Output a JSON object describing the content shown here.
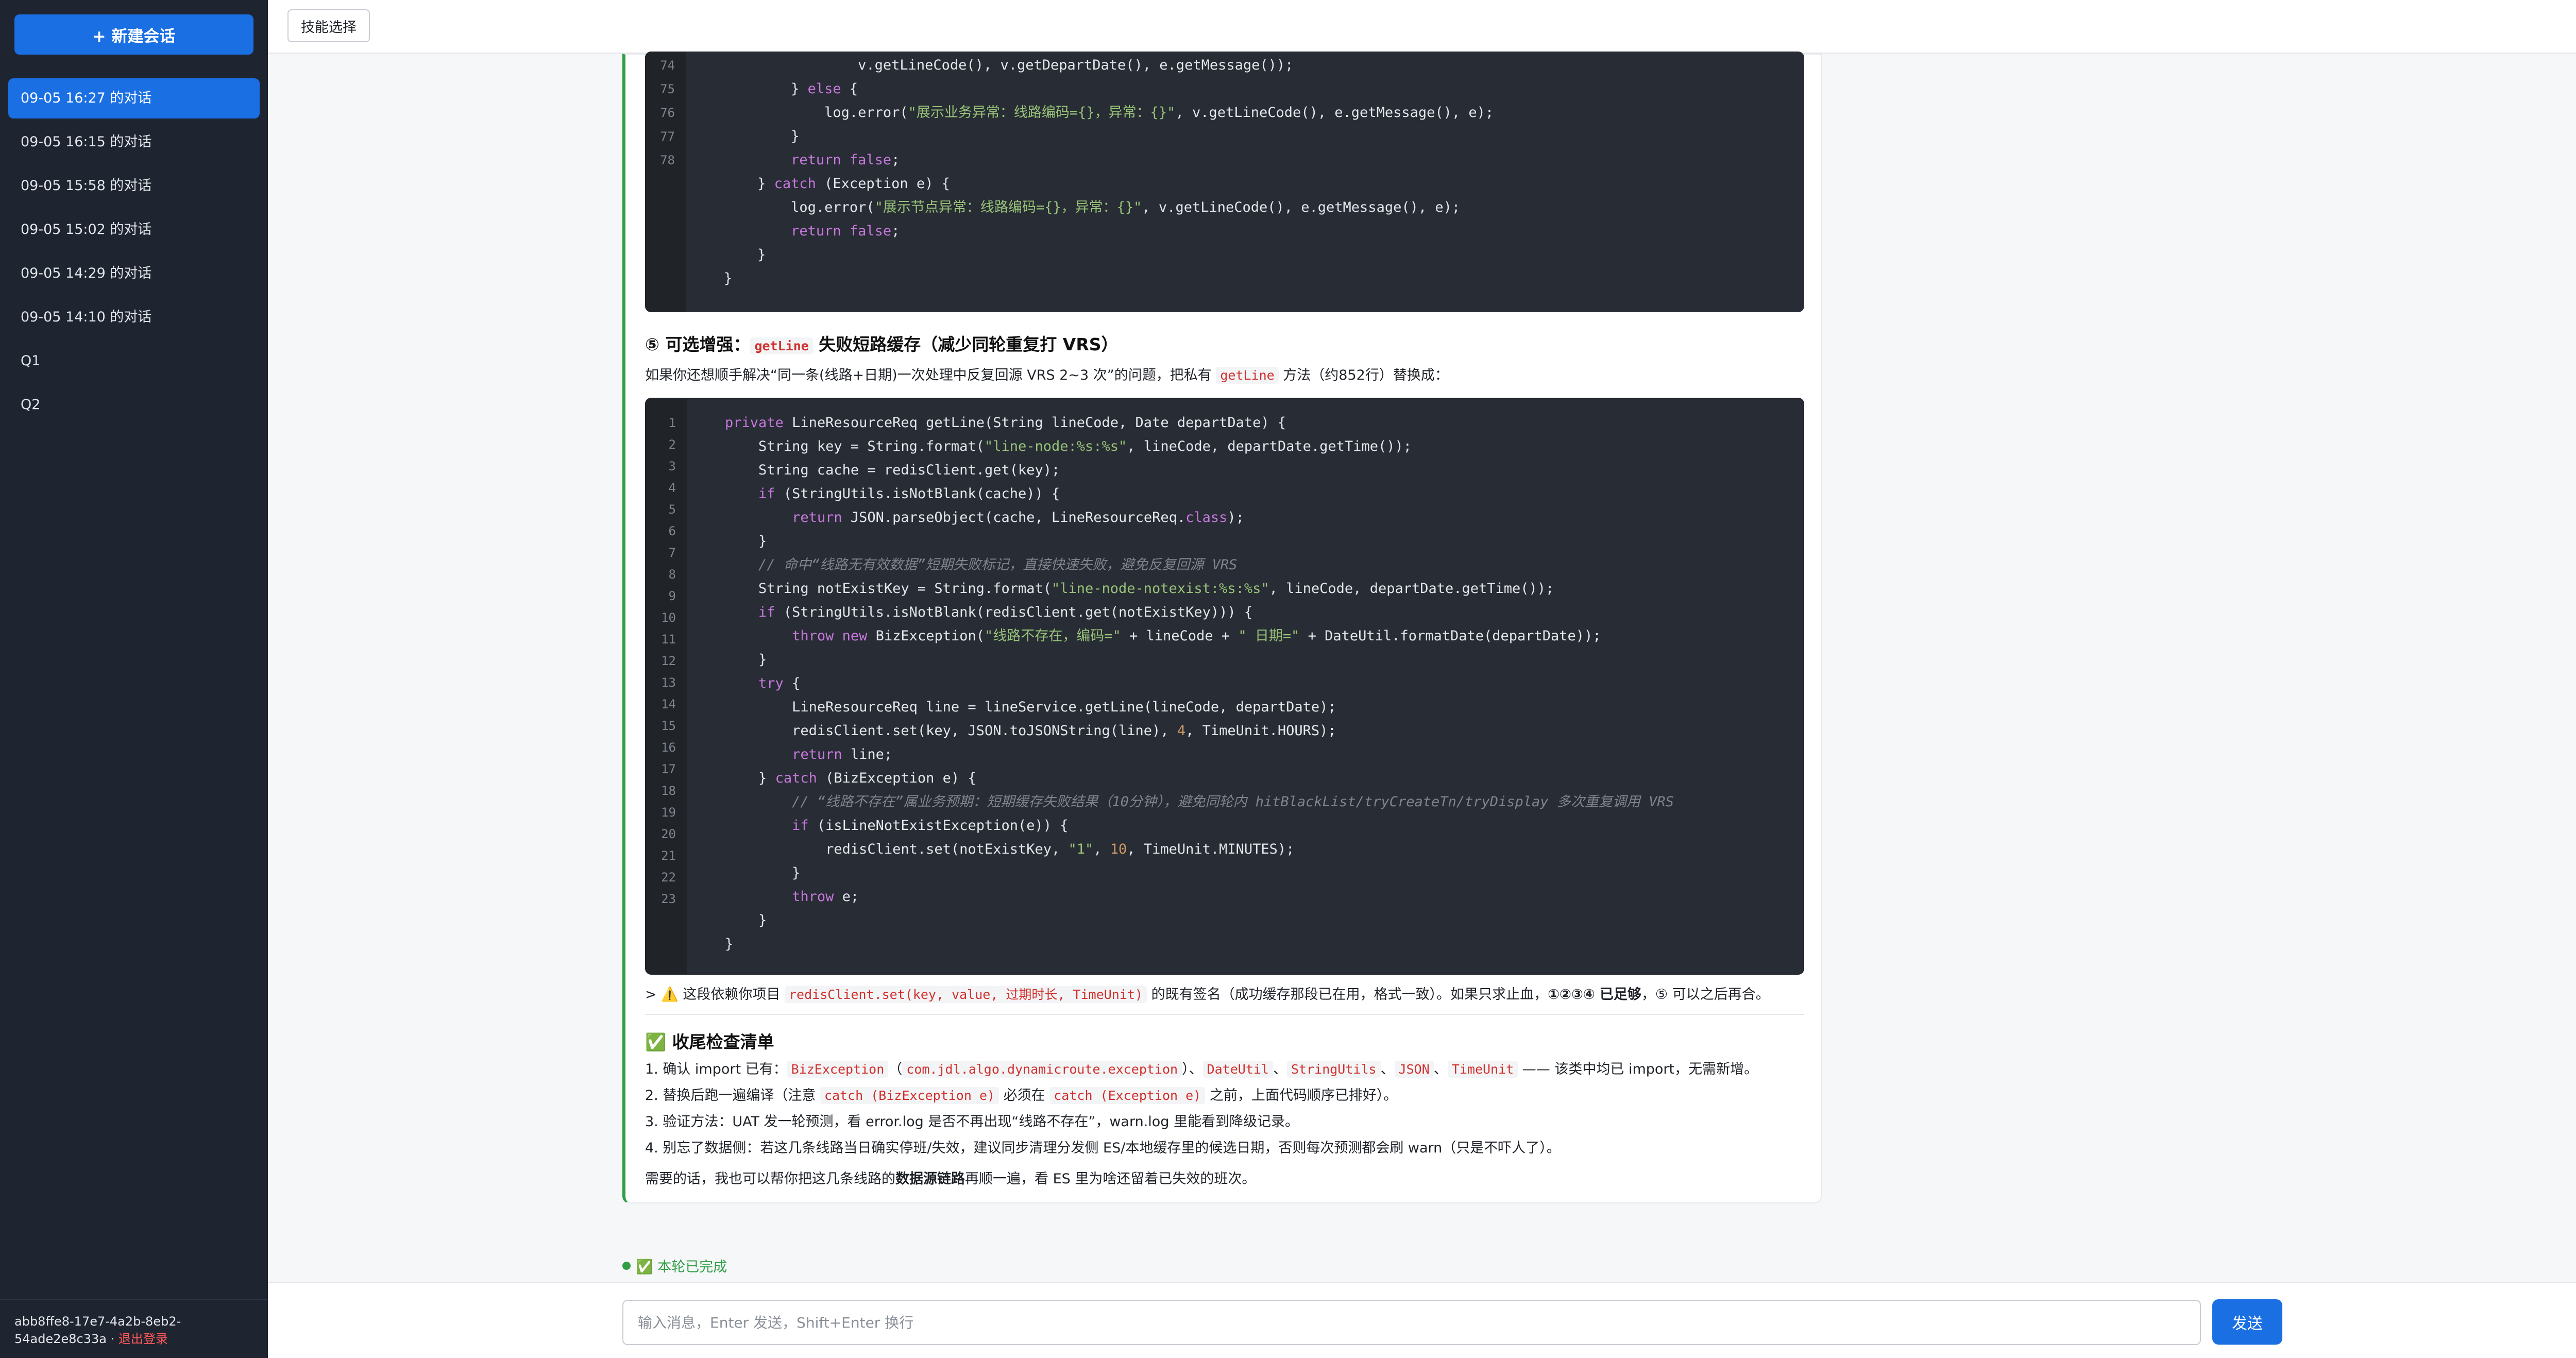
{
  "sidebar": {
    "new_chat_label": "+ 新建会话",
    "conversations": [
      "09-05 16:27 的对话",
      "09-05 16:15 的对话",
      "09-05 15:58 的对话",
      "09-05 15:02 的对话",
      "09-05 14:29 的对话",
      "09-05 14:10 的对话",
      "Q1",
      "Q2"
    ],
    "user_id_line1": "abb8ffe8-17e7-4a2b-8eb2-",
    "user_id_line2": "54ade2e8c33a · ",
    "logout_label": "退出登录"
  },
  "topbar": {
    "skill_label": "技能选择"
  },
  "message": {
    "code1": {
      "lines": [
        {
          "no": "74",
          "html": "                    v.getLineCode(), v.getDepartDate(), e.getMessage());"
        },
        {
          "no": "75",
          "html": "            } <span class='k'>else</span> {"
        },
        {
          "no": "76",
          "html": "                log.error(<span class='s'>\"展示业务异常：线路编码={}，异常：{}\"</span>, v.getLineCode(), e.getMessage(), e);"
        },
        {
          "no": "77",
          "html": "            }"
        },
        {
          "no": "78",
          "html": "            <span class='k'>return</span> <span class='k'>false</span>;"
        },
        {
          "no": "",
          "html": "        } <span class='k'>catch</span> (Exception e) {"
        },
        {
          "no": "",
          "html": "            log.error(<span class='s'>\"展示节点异常：线路编码={}，异常：{}\"</span>, v.getLineCode(), e.getMessage(), e);"
        },
        {
          "no": "",
          "html": "            <span class='k'>return</span> <span class='k'>false</span>;"
        },
        {
          "no": "",
          "html": "        }"
        },
        {
          "no": "",
          "html": "    }"
        }
      ]
    },
    "section5": {
      "title_pre": "⑤ 可选增强：",
      "title_code": "getLine",
      "title_post": " 失败短路缓存（减少同轮重复打 VRS）",
      "desc_pre": "如果你还想顺手解决“同一条(线路+日期)一次处理中反复回源 VRS 2~3 次”的问题，把私有 ",
      "desc_code": "getLine",
      "desc_post": " 方法（约852行）替换成："
    },
    "code2": {
      "lines": [
        {
          "no": "1",
          "html": "    <span class='k'>private</span> LineResourceReq getLine(String lineCode, Date departDate) {"
        },
        {
          "no": "2",
          "html": "        String key = String.format(<span class='s'>\"line-node:%s:%s\"</span>, lineCode, departDate.getTime());"
        },
        {
          "no": "3",
          "html": "        String cache = redisClient.get(key);"
        },
        {
          "no": "4",
          "html": "        <span class='k'>if</span> (StringUtils.isNotBlank(cache)) {"
        },
        {
          "no": "5",
          "html": "            <span class='k'>return</span> JSON.parseObject(cache, LineResourceReq.<span class='k'>class</span>);"
        },
        {
          "no": "6",
          "html": "        }"
        },
        {
          "no": "7",
          "html": "        <span class='c'>// 命中“线路无有效数据”短期失败标记，直接快速失败，避免反复回源 VRS</span>"
        },
        {
          "no": "8",
          "html": "        String notExistKey = String.format(<span class='s'>\"line-node-notexist:%s:%s\"</span>, lineCode, departDate.getTime());"
        },
        {
          "no": "9",
          "html": "        <span class='k'>if</span> (StringUtils.isNotBlank(redisClient.get(notExistKey))) {"
        },
        {
          "no": "10",
          "html": "            <span class='k'>throw</span> <span class='k'>new</span> BizException(<span class='s'>\"线路不存在，编码=\"</span> + lineCode + <span class='s'>\" 日期=\"</span> + DateUtil.formatDate(departDate));"
        },
        {
          "no": "11",
          "html": "        }"
        },
        {
          "no": "12",
          "html": "        <span class='k'>try</span> {"
        },
        {
          "no": "13",
          "html": "            LineResourceReq line = lineService.getLine(lineCode, departDate);"
        },
        {
          "no": "14",
          "html": "            redisClient.set(key, JSON.toJSONString(line), <span class='n'>4</span>, TimeUnit.HOURS);"
        },
        {
          "no": "15",
          "html": "            <span class='k'>return</span> line;"
        },
        {
          "no": "16",
          "html": "        } <span class='k'>catch</span> (BizException e) {"
        },
        {
          "no": "17",
          "html": "            <span class='c'>// “线路不存在”属业务预期：短期缓存失败结果（10分钟），避免同轮内 hitBlackList/tryCreateTn/tryDisplay 多次重复调用 VRS</span>"
        },
        {
          "no": "18",
          "html": "            <span class='k'>if</span> (isLineNotExistException(e)) {"
        },
        {
          "no": "19",
          "html": "                redisClient.set(notExistKey, <span class='s'>\"1\"</span>, <span class='n'>10</span>, TimeUnit.MINUTES);"
        },
        {
          "no": "20",
          "html": "            }"
        },
        {
          "no": "21",
          "html": "            <span class='k'>throw</span> e;"
        },
        {
          "no": "22",
          "html": "        }"
        },
        {
          "no": "23",
          "html": "    }"
        }
      ]
    },
    "note": {
      "pre": "> ⚠️ 这段依赖你项目 ",
      "code": "redisClient.set(key, value, 过期时长, TimeUnit)",
      "mid": " 的既有签名（成功缓存那段已在用，格式一致）。如果只求止血，",
      "bold": "①②③④ 已足够",
      "post": "，⑤ 可以之后再合。"
    },
    "checklist": {
      "title": "✅ 收尾检查清单",
      "item1": {
        "a": "确认 import 已有：",
        "c1": "BizException",
        "b": "（",
        "c2": "com.jdl.algo.dynamicroute.exception",
        "c": "）、",
        "c3": "DateUtil",
        "d": "、",
        "c4": "StringUtils",
        "e": "、",
        "c5": "JSON",
        "f": "、",
        "c6": "TimeUnit",
        "g": " —— 该类中均已 import，无需新增。"
      },
      "item2": {
        "a": "替换后跑一遍编译（注意 ",
        "c1": "catch (BizException e)",
        "b": " 必须在 ",
        "c2": "catch (Exception e)",
        "c": " 之前，上面代码顺序已排好）。"
      },
      "item3": "验证方法：UAT 发一轮预测，看 error.log 是否不再出现“线路不存在”，warn.log 里能看到降级记录。",
      "item4": "别忘了数据侧：若这几条线路当日确实停班/失效，建议同步清理分发侧 ES/本地缓存里的候选日期，否则每次预测都会刷 warn（只是不吓人了）。"
    },
    "closing": {
      "pre": "需要的话，我也可以帮你把这几条线路的",
      "bold": "数据源链路",
      "post": "再顺一遍，看 ES 里为啥还留着已失效的班次。"
    }
  },
  "status": {
    "text": "✅ 本轮已完成"
  },
  "input": {
    "placeholder": "输入消息，Enter 发送，Shift+Enter 换行",
    "send_label": "发送"
  },
  "colors": {
    "accent": "#1a6fe3",
    "sidebar_bg": "#1e2430",
    "success": "#2f9e44",
    "code_bg": "#282c34"
  }
}
